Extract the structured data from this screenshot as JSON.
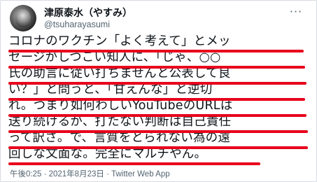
{
  "tweet": {
    "display_name": "津原泰水（やすみ）",
    "handle": "@tsuharayasumi",
    "more_icon": "more-dots-icon",
    "lines": [
      "コロナのワクチン「よく考えて」とメッ",
      "セージがしつこい知人に、「じゃ、○○",
      "氏の助言に従い打ちませんと公表して良",
      "い？」と問うと、「甘えんな」と逆切",
      "れ。つまり如何わしいYouTubeのURLは",
      "送り続けるが、打たない判断は自己責任",
      "って訳さ。で、言質をとられない為の遠",
      "回しな文面な。完全にマルチやん。"
    ],
    "timestamp": "午後0:25 · 2021年8月23日 · Twitter Web App"
  },
  "colors": {
    "underline": "#e8001c",
    "text": "#0f1419",
    "muted": "#536471"
  }
}
